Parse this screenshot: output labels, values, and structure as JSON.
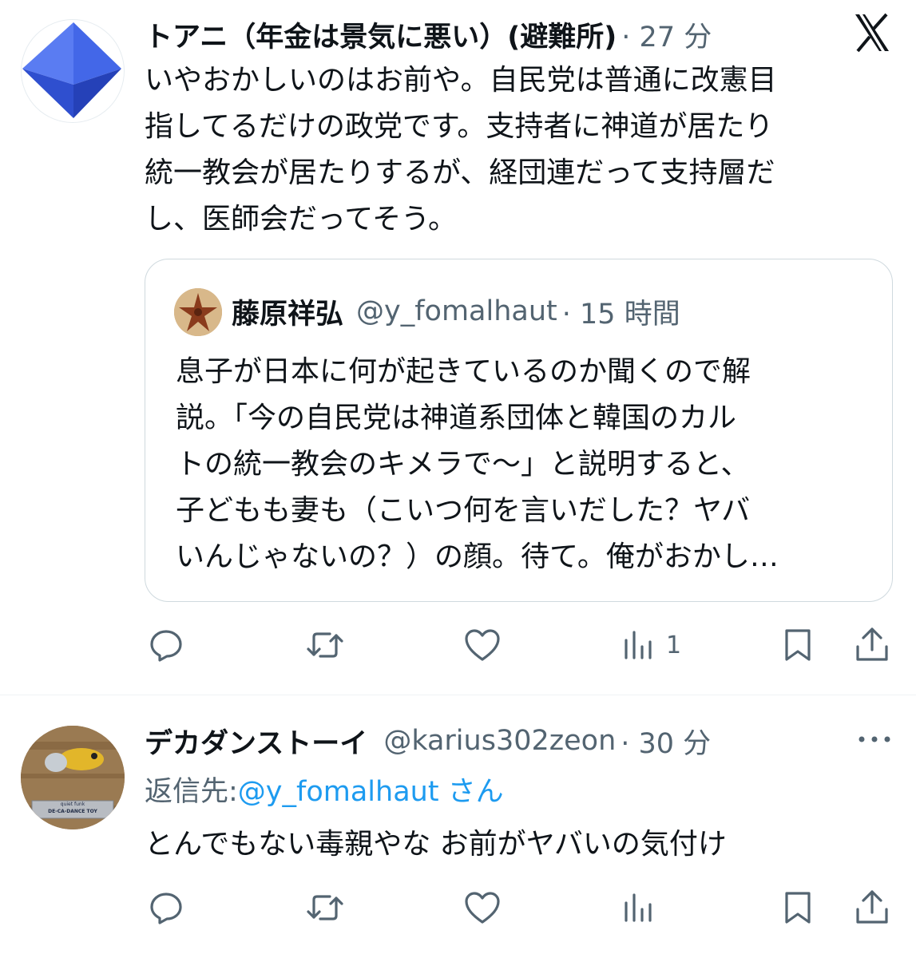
{
  "post1": {
    "author_name": "トアニ（年金は景気に悪い）(避難所)",
    "time": "· 27 分",
    "body": [
      "いやおかしいのはお前や。自民党は普通に改憲目",
      "指してるだけの政党です。支持者に神道が居たり",
      "統一教会が居たりするが、経団連だって支持層だ",
      "し、医師会だってそう。"
    ],
    "quote": {
      "author_name": "藤原祥弘",
      "handle": "@y_fomalhaut",
      "time": "· 15 時間",
      "body": [
        "息子が日本に何が起きているのか聞くので解",
        "説。「今の自民党は神道系団体と韓国のカル",
        "トの統一教会のキメラで〜」と説明すると、",
        "子どもも妻も（こいつ何を言いだした？ヤバ",
        "いんじゃないの？）の顔。待て。俺がおかし…"
      ]
    },
    "actions": {
      "views_count": "1"
    }
  },
  "post2": {
    "author_name": "デカダンストーイ",
    "handle": "@karius302zeon",
    "time": "· 30 分",
    "reply_prefix": "返信先: ",
    "reply_target": "@y_fomalhaut さん",
    "avatar_label_1": "quiet funk",
    "avatar_label_2": "DE-CA-DANCE TOY",
    "body": [
      "とんでもない毒親やな お前がヤバいの気付け"
    ]
  },
  "icons": {
    "brand": "x-logo-icon",
    "reply": "reply-icon",
    "repost": "repost-icon",
    "like": "heart-icon",
    "views": "views-icon",
    "bookmark": "bookmark-icon",
    "share": "share-icon",
    "more": "more-icon"
  },
  "colors": {
    "text": "#0f1419",
    "muted": "#536471",
    "link": "#1d9bf0",
    "border": "#cfd9de",
    "avatar1": "#3a5fe0"
  }
}
